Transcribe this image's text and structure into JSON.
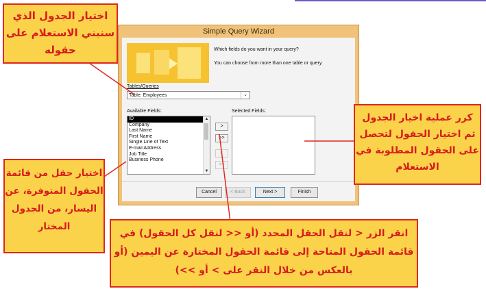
{
  "dialog": {
    "title": "Simple Query Wizard",
    "prompt_fields": "Which fields do you want in your query?",
    "prompt_tables": "You can choose from more than one table or query.",
    "tables_label": "Tables/Queries",
    "table_value": "Table: Employees",
    "available_label": "Available Fields:",
    "selected_label": "Selected Fields:",
    "available_fields": [
      "ID",
      "Company",
      "Last Name",
      "First Name",
      "Single Line of Text",
      "E-mail Address",
      "Job Title",
      "Business Phone"
    ],
    "selected_index": 0,
    "move_buttons": [
      ">",
      ">>",
      "<",
      "<<"
    ],
    "buttons": {
      "cancel": "Cancel",
      "back": "< Back",
      "next": "Next >",
      "finish": "Finish"
    }
  },
  "callouts": {
    "choose_table": "اختيار الجدول الذي سنبني الاستعلام على حقوله",
    "repeat": "كرر عملية اخيار الجدول ثم اختيار الحقول لتحصل على الحقول المطلوبة في الاستعلام",
    "choose_field": "اختيار حقل من قائمة الحقول المتوفرة، عن اليسار، من الجدول المختار",
    "move_buttons": "انقر الزر < لنقل الحقل المحدد (أو << لنقل كل الحقول) في قائمة الحقول المتاحة إلى قائمة الحقول المختارة عن اليمين (أو بالعكس من خلال النقر على > أو >>)"
  },
  "colors": {
    "callout_bg": "#fbd34a",
    "callout_border": "#e0261d",
    "callout_text": "#d71b1b",
    "window_frame": "#f0c27a"
  }
}
